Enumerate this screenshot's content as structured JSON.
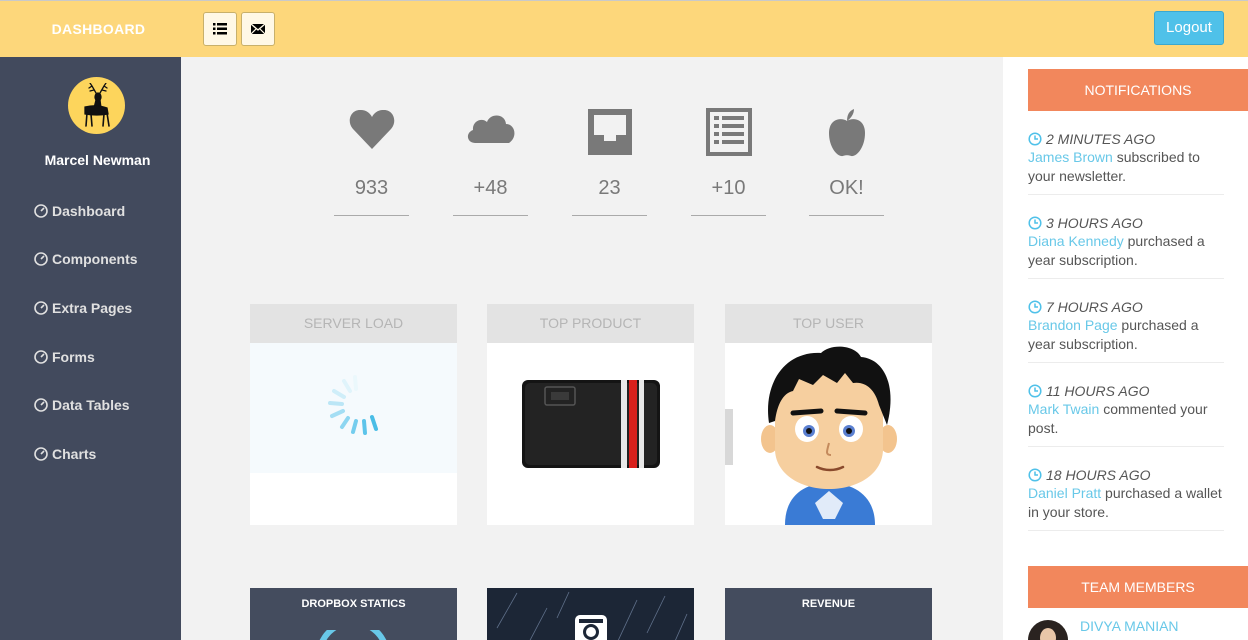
{
  "brand": "DASHBOARD",
  "topbar": {
    "menu_icon": "list-icon",
    "mail_icon": "envelope-icon",
    "logout_label": "Logout"
  },
  "user": {
    "name": "Marcel Newman",
    "avatar_icon": "deer-icon"
  },
  "sidebar": {
    "items": [
      {
        "label": "Dashboard",
        "icon": "dashboard-icon"
      },
      {
        "label": "Components",
        "icon": "dashboard-icon"
      },
      {
        "label": "Extra Pages",
        "icon": "dashboard-icon"
      },
      {
        "label": "Forms",
        "icon": "dashboard-icon"
      },
      {
        "label": "Data Tables",
        "icon": "dashboard-icon"
      },
      {
        "label": "Charts",
        "icon": "dashboard-icon"
      }
    ]
  },
  "stats": [
    {
      "icon": "heart-icon",
      "value": "933"
    },
    {
      "icon": "cloud-icon",
      "value": "+48"
    },
    {
      "icon": "inbox-icon",
      "value": "23"
    },
    {
      "icon": "list-alt-icon",
      "value": "+10"
    },
    {
      "icon": "apple-icon",
      "value": "OK!"
    }
  ],
  "panels": [
    {
      "title": "SERVER LOAD"
    },
    {
      "title": "TOP PRODUCT"
    },
    {
      "title": "TOP USER"
    }
  ],
  "bottom_panels": [
    {
      "title": "DROPBOX STATICS"
    },
    {
      "title": ""
    },
    {
      "title": "REVENUE"
    }
  ],
  "notifications": {
    "title": "NOTIFICATIONS",
    "items": [
      {
        "time": "2 MINUTES AGO",
        "who": "James Brown",
        "text": " subscribed to your newsletter."
      },
      {
        "time": "3 HOURS AGO",
        "who": "Diana Kennedy",
        "text": " purchased a year subscription."
      },
      {
        "time": "7 HOURS AGO",
        "who": "Brandon Page",
        "text": " purchased a year subscription."
      },
      {
        "time": "11 HOURS AGO",
        "who": "Mark Twain",
        "text": " commented your post."
      },
      {
        "time": "18 HOURS AGO",
        "who": "Daniel Pratt",
        "text": " purchased a wallet in your store."
      }
    ]
  },
  "team": {
    "title": "TEAM MEMBERS",
    "members": [
      {
        "name": "DIVYA MANIAN"
      }
    ]
  },
  "colors": {
    "topbar": "#fdd77b",
    "sidebar": "#424a5d",
    "accent_orange": "#f2875c",
    "accent_blue": "#4fc1e9",
    "link_blue": "#68c8e8"
  }
}
